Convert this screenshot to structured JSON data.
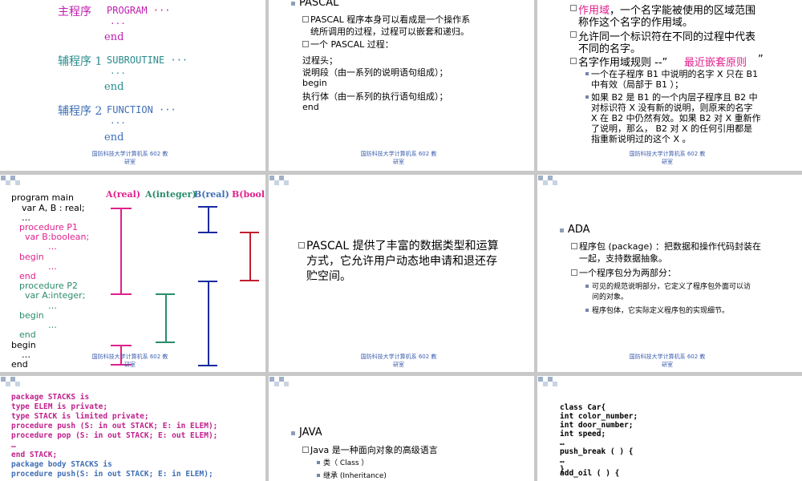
{
  "footer": "国防科技大学计算机系 602 教研室",
  "slide1": {
    "lines": [
      "主程序",
      "PROGRAM ···",
      "···",
      "end",
      "辅程序 1",
      "SUBROUTINE ···",
      "···",
      "end",
      "辅程序 2",
      "FUNCTION ···",
      "···",
      "end"
    ]
  },
  "slide2": {
    "title": "PASCAL",
    "b1": "PASCAL 程序本身可以看成是一个操作系统所调用的过程，过程可以嵌套和递归。",
    "b1a": "PASCAL 程序本身可以看成是一个操作系",
    "b1b": "统所调用的过程，过程可以嵌套和递归。",
    "b2": "一个 PASCAL 过程：",
    "l1": "过程头；",
    "l2": "说明段（由一系列的说明语句组成）；",
    "l3": "begin",
    "l4": "执行体（由一系列的执行语句组成）；",
    "l5": "end"
  },
  "slide3": {
    "b1_em": "作用域",
    "b1a": "，一个名字能被使用的区域范围",
    "b1b": "称作这个名字的作用域。",
    "b2a": "允许同一个标识符在不同的过程中代表",
    "b2b": "不同的名字。",
    "b3a": "名字作用域规则 --”",
    "b3_em": "最近嵌套原则",
    "b3b": "”",
    "s1a": "一个在子程序 B1 中说明的名字 X 只在 B1",
    "s1b": "中有效（局部于 B1 ）；",
    "s2a": "如果 B2 是 B1 的一个内层子程序且 B2 中",
    "s2b": "对标识符 X 没有新的说明，则原来的名字",
    "s2c": "X 在 B2 中仍然有效。如果 B2 对 X 重新作",
    "s2d": "了说明，那么， B2 对 X 的任何引用都是",
    "s2e": "指重新说明过的这个 X 。"
  },
  "slide4": {
    "heads": [
      "A(real)",
      "A(integer)",
      "B(real)",
      "B(bool)"
    ],
    "code": [
      "program main",
      "var  A, B : real;",
      "…",
      "procedure P1",
      "var B:boolean;",
      "…",
      "begin",
      "…",
      "end",
      "procedure P2",
      "var A:integer;",
      "…",
      "begin",
      "…",
      "end",
      "begin",
      "…",
      "end"
    ]
  },
  "slide5": {
    "b1a": "PASCAL 提供了丰富的数据类型和运算",
    "b1b": "方式，它允许用户动态地申请和退还存",
    "b1c": "贮空间。"
  },
  "slide6": {
    "title": "ADA",
    "b1a": "程序包 (package) ：把数据和操作代码封装在",
    "b1b": "一起，支持数据抽象。",
    "b2": "一个程序包分为两部分：",
    "s1a": "可见的规范说明部分，它定义了程序包外面可以访",
    "s1b": "问的对象。",
    "s2": "程序包体，它实际定义程序包的实现细节。"
  },
  "slide7": {
    "code": [
      "package STACKS is",
      "  type ELEM is private;",
      "  type STACK is limited private;",
      "  procedure push (S: in out STACK; E: in ELEM);",
      "  procedure pop (S: in out STACK; E: out ELEM);",
      "  …",
      "end STACK;",
      "package body STACKS is",
      "  procedure push(S: in out STACK; E: in ELEM);"
    ]
  },
  "slide8": {
    "title": "JAVA",
    "b1": "Java 是一种面向对象的高级语言",
    "s1": "类（ Class ）",
    "s2": "继承 (Inheritance)"
  },
  "slide9": {
    "code": [
      "class Car{",
      "  int color_number;",
      "  int door_number;",
      "  int speed;",
      "  …",
      "  push_break ( ) {",
      "  …",
      "  }",
      "  add_oil ( ) {",
      "  …"
    ]
  }
}
